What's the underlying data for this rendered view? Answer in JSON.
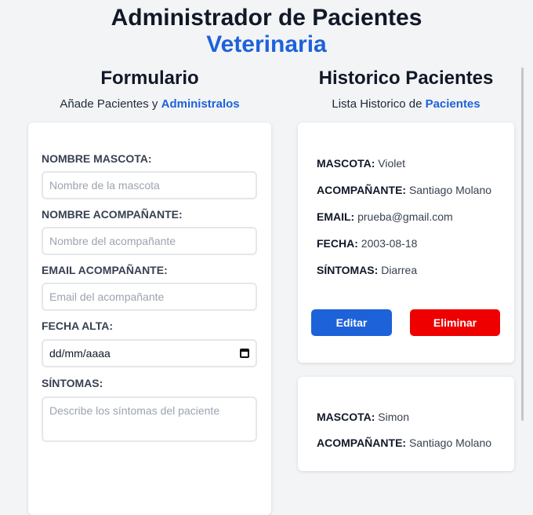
{
  "header": {
    "title": "Administrador de Pacientes",
    "title_accent": "Veterinaria"
  },
  "form_column": {
    "heading": "Formulario",
    "subtitle_prefix": "Añade Pacientes y ",
    "subtitle_accent": "Administralos"
  },
  "form": {
    "fields": [
      {
        "label": "Nombre Mascota:",
        "placeholder": "Nombre de la mascota"
      },
      {
        "label": "Nombre Acompañante:",
        "placeholder": "Nombre del acompañante"
      },
      {
        "label": "Email Acompañante:",
        "placeholder": "Email del acompañante"
      },
      {
        "label": "Fecha Alta:",
        "value": "dd/mm/aaaa",
        "icon": "calendar-icon"
      },
      {
        "label": "Síntomas:",
        "placeholder": "Describe los síntomas del paciente"
      }
    ]
  },
  "history_column": {
    "heading": "Historico Pacientes",
    "subtitle_prefix": "Lista Historico de ",
    "subtitle_accent": "Pacientes"
  },
  "patients": [
    {
      "labels": {
        "mascota": "Mascota:",
        "acompanante": "Acompañante:",
        "email": "Email:",
        "fecha": "Fecha:",
        "sintomas": "Síntomas:"
      },
      "mascota": "Violet",
      "acompanante": "Santiago Molano",
      "email": "prueba@gmail.com",
      "fecha": "2003-08-18",
      "sintomas": "Diarrea",
      "edit_label": "Editar",
      "delete_label": "Eliminar"
    },
    {
      "labels": {
        "mascota": "Mascota:",
        "acompanante": "Acompañante:"
      },
      "mascota": "Simon",
      "acompanante": "Santiago Molano"
    }
  ],
  "colors": {
    "accent": "#1d62d9",
    "danger": "#ef0000",
    "background": "#f3f4f6"
  }
}
